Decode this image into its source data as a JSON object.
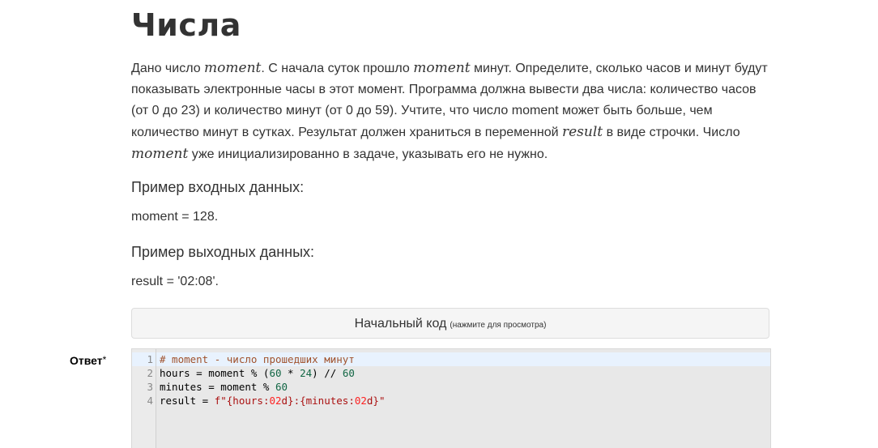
{
  "title": "Числа",
  "description": {
    "p1": "Дано число ",
    "m1": "moment",
    "p2": ". С начала суток прошло ",
    "m2": "moment",
    "p3": " минут. Определите, сколько часов и минут будут показывать электронные часы в этот момент. Программа должна вывести два числа: количество часов (от 0 до 23) и количество минут (от 0 до 59). Учтите, что число moment может быть больше, чем количество минут в сутках. Результат должен храниться в переменной ",
    "m3": "result",
    "p4": " в виде строчки. Число ",
    "m4": "moment",
    "p5": " уже инициализированно в задаче, указывать его не нужно."
  },
  "example_input": {
    "heading": "Пример входных данных:",
    "value": "moment = 128."
  },
  "example_output": {
    "heading": "Пример выходных данных:",
    "value": "result = '02:08'."
  },
  "initial_code": {
    "label": "Начальный код",
    "hint": "(нажмите для просмотра)"
  },
  "answer": {
    "label": "Ответ",
    "required_mark": "*"
  },
  "editor": {
    "lines": [
      {
        "num": "1",
        "parts": [
          {
            "t": "# moment - число прошедших минут",
            "c": "comment"
          }
        ]
      },
      {
        "num": "2",
        "parts": [
          {
            "t": "hours = moment % (",
            "c": ""
          },
          {
            "t": "60",
            "c": "num"
          },
          {
            "t": " * ",
            "c": ""
          },
          {
            "t": "24",
            "c": "num"
          },
          {
            "t": ") // ",
            "c": ""
          },
          {
            "t": "60",
            "c": "num"
          }
        ]
      },
      {
        "num": "3",
        "parts": [
          {
            "t": "minutes = moment % ",
            "c": ""
          },
          {
            "t": "60",
            "c": "num"
          }
        ]
      },
      {
        "num": "4",
        "parts": [
          {
            "t": "result = ",
            "c": ""
          },
          {
            "t": "f\"{hours:",
            "c": "str"
          },
          {
            "t": "02",
            "c": "fmt"
          },
          {
            "t": "d}:{minutes:",
            "c": "str"
          },
          {
            "t": "02",
            "c": "fmt"
          },
          {
            "t": "d}\"",
            "c": "str"
          }
        ]
      }
    ]
  }
}
